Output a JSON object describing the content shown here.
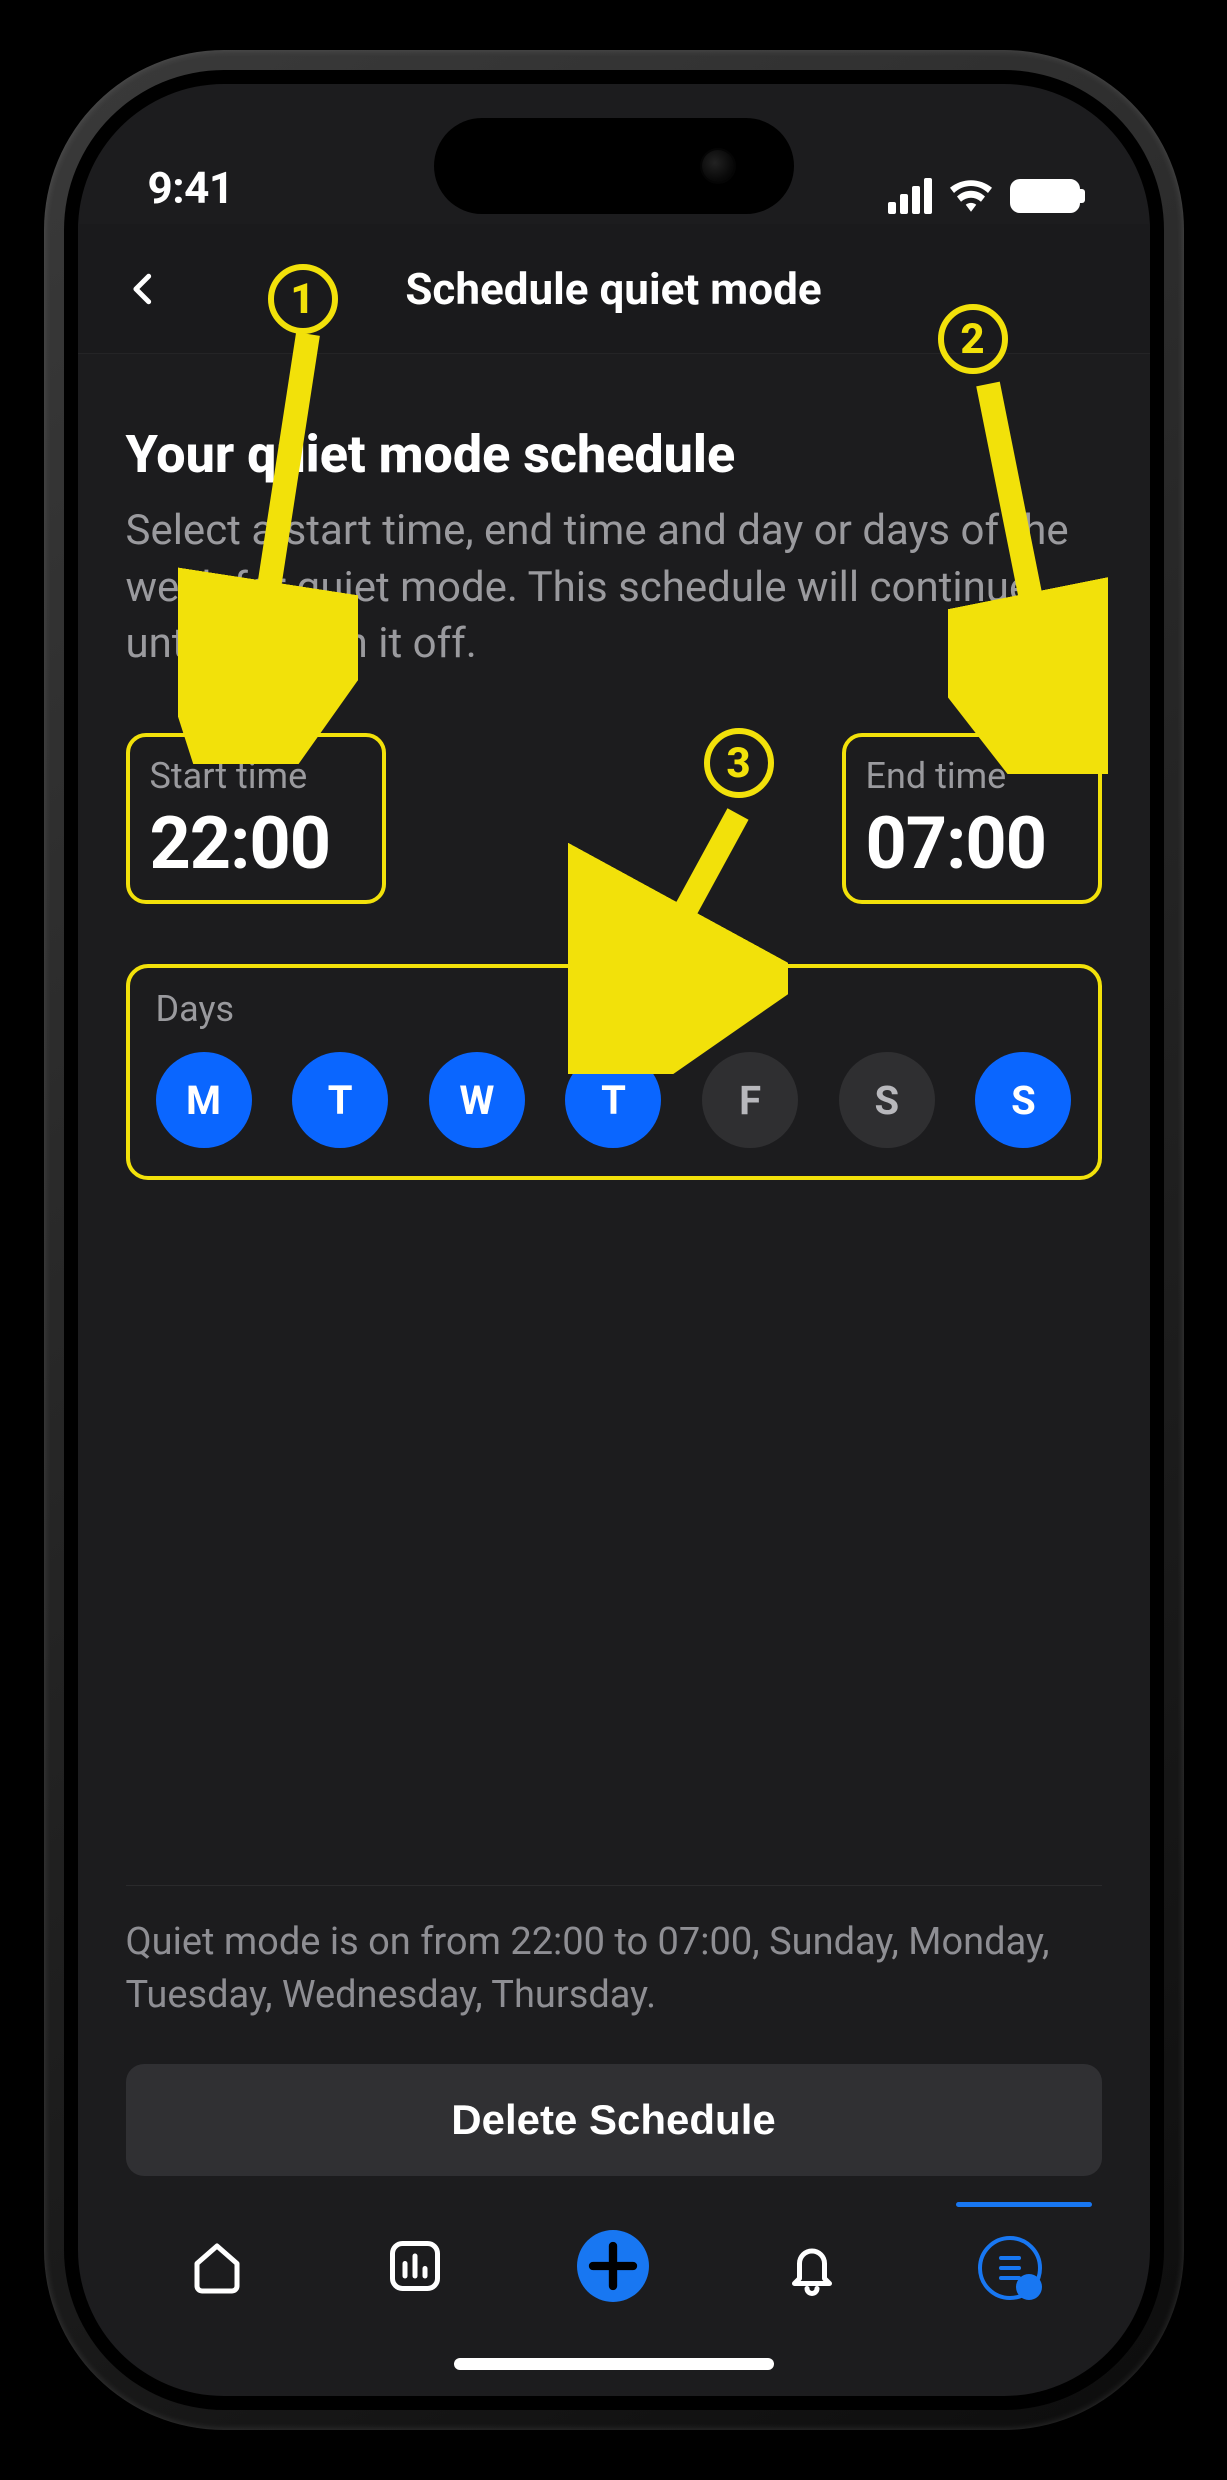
{
  "status": {
    "time": "9:41"
  },
  "nav": {
    "title": "Schedule quiet mode"
  },
  "heading": "Your quiet mode schedule",
  "description": "Select a start time, end time and day or days of the week for quiet mode. This schedule will continue until you turn it off.",
  "start_time": {
    "label": "Start time",
    "value": "22:00"
  },
  "end_time": {
    "label": "End time",
    "value": "07:00"
  },
  "days": {
    "label": "Days",
    "items": [
      {
        "letter": "M",
        "selected": true
      },
      {
        "letter": "T",
        "selected": true
      },
      {
        "letter": "W",
        "selected": true
      },
      {
        "letter": "T",
        "selected": true
      },
      {
        "letter": "F",
        "selected": false
      },
      {
        "letter": "S",
        "selected": false
      },
      {
        "letter": "S",
        "selected": true
      }
    ]
  },
  "summary": "Quiet mode is on from 22:00 to 07:00, Sunday, Monday, Tuesday, Wednesday, Thursday.",
  "delete_label": "Delete Schedule",
  "annotations": {
    "a1": "1",
    "a2": "2",
    "a3": "3"
  }
}
